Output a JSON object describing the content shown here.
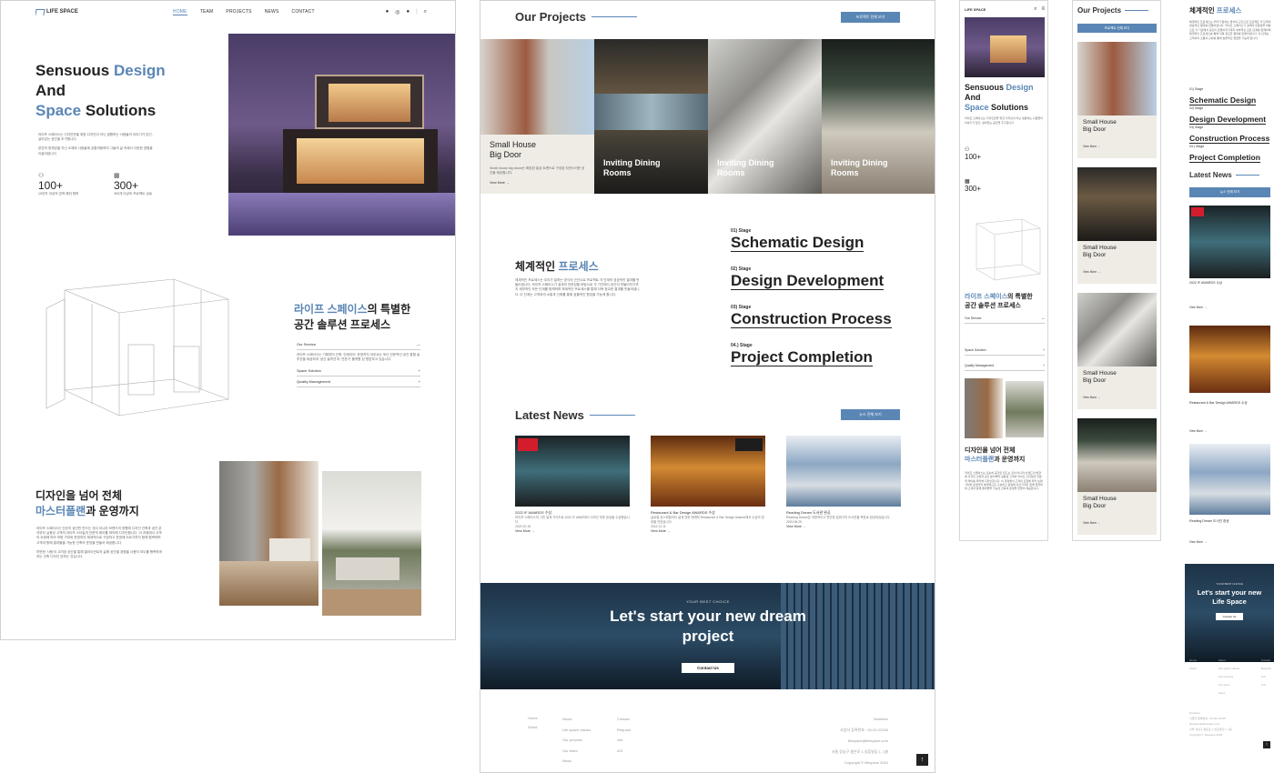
{
  "brand": {
    "logo": "LIFE SPACE"
  },
  "nav": {
    "home": "HOME",
    "team": "TEAM",
    "projects": "PROJECTS",
    "news": "NEWS",
    "contact": "CONTACT"
  },
  "hero": {
    "title_1": "Sensuous ",
    "title_1_accent": "Design",
    "title_2": "And",
    "title_3_accent": "Space",
    "title_3": " Solutions",
    "desc_1": "라이프 스페이스는 디자인만을 위한 디자인이 아닌 생활하는 사람들의 이야기가 담긴,",
    "desc_2": "살아있는 공간을 추구합니다.",
    "desc_3": "본연의 정체성을 지닌 소재와 사람들에 공통적용하여 그들의 삶 속에서 다양한 경험을",
    "desc_4": "이끌어냅니다.",
    "stat1_num": "100+",
    "stat1_label": "10년차 이상의 업력 예외 협력",
    "stat2_num": "300+",
    "stat2_label": "300개 이상의 프로젝트 성료"
  },
  "service": {
    "title_accent": "라이프 스페이스",
    "title_rest": "의 특별한",
    "title_2": "공간 솔루션 프로세스",
    "acc1": "Our Service",
    "acc1_text": "라이프 스페이스는 기획부터 건축, 인테리어, 운영까지 아우르는 토다 전문적인 공간 통합 솔루션을 제공하여 '공간 솔루션'과 '전문가' 플랫폼 된 협업하고 있습니다.",
    "acc2": "Space Solution",
    "acc3": "Quality Management"
  },
  "masterplan": {
    "title_1": "디자인을 넘어 전체",
    "title_2_accent": "마스터플랜",
    "title_2_rest": "과 운영까지",
    "p1": "라이프 스페이스는 단순히 공간만 만드는 것이 아니라 브랜드의 방향에 디자인 건축과 공간 분석부터 실용성 고객의 라이프 스타일과 전문적 레이를 파악해 디자인합니다. 이 과정에서 고객의 요청에 따라 보편 가치와 운영까지 체계적으로 구성하고 운영에 이르기까지 함께 협력하며 고객과 함께 결과물을 가능한 건축의 운영을 만들어 제공합니다.",
    "p2": "따뜻한 '사람'이 고려된 공간을 통해 클라이언트의 삶에 공간을 경험을 사용자 모두를 행복하게 하는 건축 디자인 당하는 것입니다."
  },
  "projects": {
    "title": "Our Projects",
    "btn": "프로젝트 전체 보기",
    "cards": [
      {
        "title_1": "Small House",
        "title_2": "Big Door",
        "desc": "Small house big doors는 확장된 일상 트렌드로 구성된 자연스러운 공간을 제공합니다.",
        "more": "View More"
      },
      {
        "title_1": "Inviting Dining",
        "title_2": "Rooms"
      },
      {
        "title_1": "Inviting Dining",
        "title_2": "Rooms"
      },
      {
        "title_1": "Inviting Dining",
        "title_2": "Rooms"
      }
    ]
  },
  "process": {
    "title_1": "체계적인 ",
    "title_accent": "프로세스",
    "p": "체계적인 프로세스는 우리가 일하는 방식의 근간으로 프로젝트 각 단계의 성공적인 결과를 만들어냅니다. 라이프 스페이스가 설계의 전문성을 바탕으로 각 기관에서 공간이 만들어지기까지 세부적인 모든 단계를 함께하며 체계적인 프로세스를 통해 더욱 정교한 결과를 만들어냅니다. 이 단계는 고객과의 소통과 신뢰를 통해 효율적인 협업을 가능케 합니다.",
    "stages": [
      {
        "label": "01) Stage",
        "title": "Schematic Design"
      },
      {
        "label": "02) Stage",
        "title": "Design Development"
      },
      {
        "label": "03) Stage",
        "title": "Construction Process"
      },
      {
        "label": "04.) Stage",
        "title": "Project Completion"
      }
    ]
  },
  "news": {
    "title": "Latest News",
    "btn": "뉴스 전체 보기",
    "items": [
      {
        "title": "2022 IF AWARDS 수상",
        "text": "라이프 스페이스의 그린 설계 가이드로 2022 IF AWARDS 디자인 부문 본상을 수상했습니다.",
        "date": "2022.02.15",
        "more": "View More"
      },
      {
        "title": "Restaurant & Bar Design AWARDS 수상",
        "text": "글로벌 호스피탈리티 설계 전문 매체의 Restaurant & Bar Design Awards에서 수상의 영광을 안았습니다.",
        "date": "2022.12.11",
        "more": "View More"
      },
      {
        "title": "Reading Dream 도서관 완공",
        "text": "Reading Dream은 개방적이고 편안한 분위기의 도서관을 목표로 완성되었습니다.",
        "date": "2020.08.25",
        "more": "View More"
      }
    ]
  },
  "cta": {
    "sub": "YOUR BEST CHOICE",
    "title_1": "Let's start your new dream",
    "title_2": "project",
    "btn": "Contact Us"
  },
  "footer": {
    "col1": [
      "Home",
      "World"
    ],
    "col2": [
      "About",
      "Life space values",
      "Our process",
      "Our team",
      "News"
    ],
    "col3": [
      "Contact",
      "Request",
      "Job",
      "A/S"
    ],
    "right": [
      "Nowhere",
      "사업자 등록번호 : 00-00-12345",
      "lifespace@lifespace.com",
      "서울 강남구 봉은로 1 성훈빌딩 1, 1층"
    ],
    "copy": "Copyright © lifespace 2024"
  },
  "m1": {
    "logo": "LIFE SPACE",
    "stat1": "100+",
    "stat2": "300+",
    "acc1": "Our Service",
    "acc2": "Space Solution",
    "acc3": "Quality Management"
  },
  "m2": {
    "title": "Our Projects",
    "btn": "프로젝트 전체 보기",
    "card_t1": "Small House",
    "card_t2": "Big Door",
    "more": "View More"
  },
  "m3": {
    "process_1": "체계적인 ",
    "process_accent": "프로세스",
    "stages": [
      {
        "label": "01) Stage",
        "title": "Schematic Design"
      },
      {
        "label": "02) Stage",
        "title": "Design Development"
      },
      {
        "label": "03) Stage",
        "title": "Construction Process"
      },
      {
        "label": "04.) Stage",
        "title": "Project Completion"
      }
    ],
    "news_title": "Latest News",
    "news_btn": "뉴스 전체 보기",
    "n1": "2022 IF AWARDS 수상",
    "n2": "Restaurant & Bar Design AWARDS 수상",
    "n3": "Reading Dream 도서관 완공",
    "more": "View More",
    "cta_sub": "YOUR BEST CHOICE",
    "cta_title": "Let's start your new Life Space",
    "cta_btn": "Contact Us"
  },
  "colors": {
    "accent": "#5a86b5",
    "dark": "#222222"
  }
}
